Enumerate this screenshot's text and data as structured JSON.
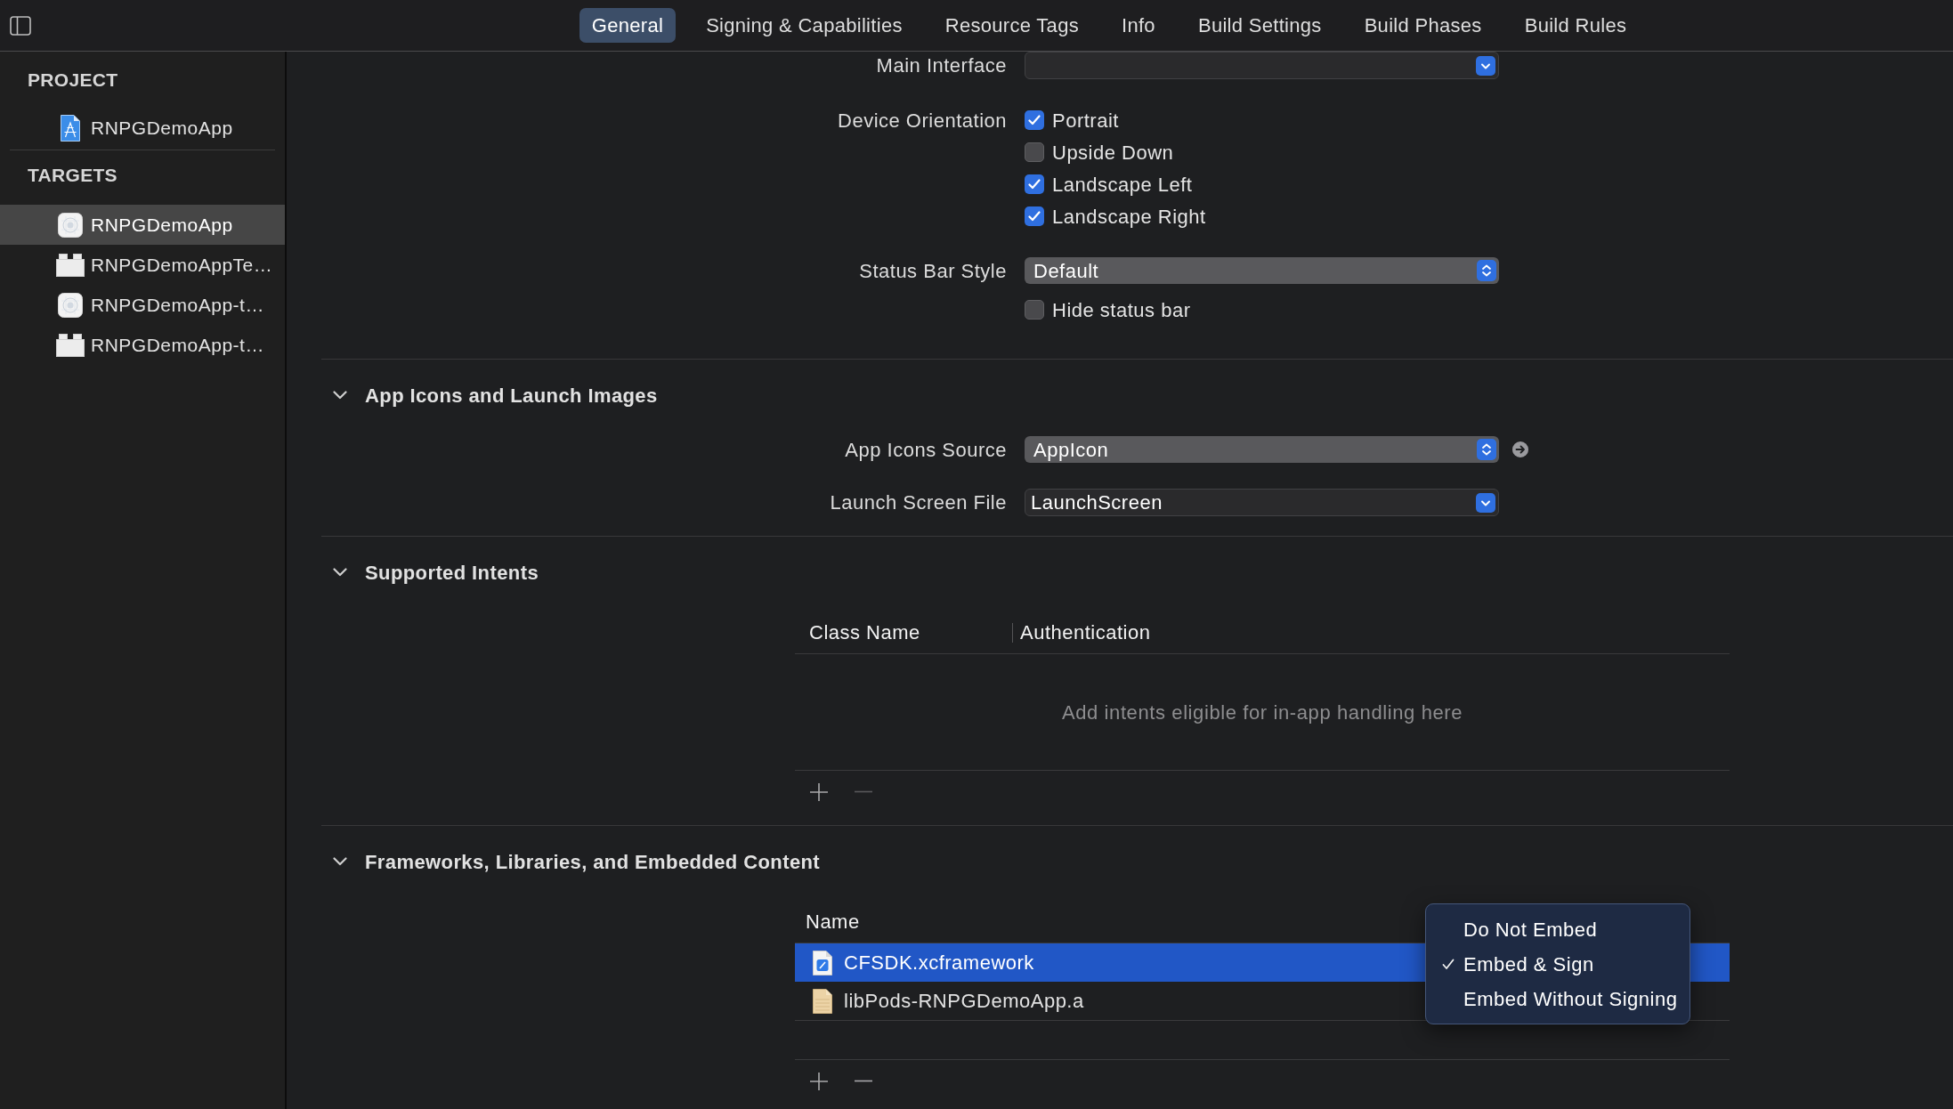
{
  "toolbar": {
    "tabs": [
      {
        "label": "General",
        "selected": true
      },
      {
        "label": "Signing & Capabilities",
        "selected": false
      },
      {
        "label": "Resource Tags",
        "selected": false
      },
      {
        "label": "Info",
        "selected": false
      },
      {
        "label": "Build Settings",
        "selected": false
      },
      {
        "label": "Build Phases",
        "selected": false
      },
      {
        "label": "Build Rules",
        "selected": false
      }
    ]
  },
  "sidebar": {
    "groups": [
      {
        "title": "PROJECT",
        "items": [
          {
            "label": "RNPGDemoApp",
            "kind": "project",
            "selected": false
          }
        ]
      },
      {
        "title": "TARGETS",
        "items": [
          {
            "label": "RNPGDemoApp",
            "kind": "app",
            "selected": true
          },
          {
            "label": "RNPGDemoAppTe…",
            "kind": "bundle",
            "selected": false
          },
          {
            "label": "RNPGDemoApp-t…",
            "kind": "app",
            "selected": false
          },
          {
            "label": "RNPGDemoApp-t…",
            "kind": "bundle",
            "selected": false
          }
        ]
      }
    ]
  },
  "sections": [
    {
      "rows": [
        {
          "kind": "popup",
          "label": "Main Interface"
        },
        {
          "kind": "checkboxes",
          "label": "Device Orientation",
          "options": [
            {
              "label": "Portrait",
              "checked": true
            },
            {
              "label": "Upside Down",
              "checked": false
            },
            {
              "label": "Landscape Left",
              "checked": true
            },
            {
              "label": "Landscape Right",
              "checked": true
            }
          ]
        },
        {
          "kind": "stepper",
          "label": "Status Bar Style",
          "value": "Default"
        },
        {
          "kind": "checkboxes",
          "options": [
            {
              "label": "Hide status bar",
              "checked": false
            }
          ]
        }
      ]
    },
    {
      "title": "App Icons and Launch Images",
      "expanded": true,
      "rows": [
        {
          "kind": "stepper",
          "label": "App Icons Source",
          "value": "AppIcon",
          "go_arrow": true
        },
        {
          "kind": "popup",
          "label": "Launch Screen File",
          "value": "LaunchScreen"
        }
      ]
    },
    {
      "title": "Supported Intents",
      "expanded": true,
      "table": {
        "columns": [
          "Class Name",
          "Authentication"
        ],
        "empty_text": "Add intents eligible for in-app handling here",
        "buttons": [
          {
            "kind": "add",
            "disabled": false
          },
          {
            "kind": "remove",
            "disabled": true
          }
        ]
      }
    },
    {
      "title": "Frameworks, Libraries, and Embedded Content",
      "expanded": true,
      "table": {
        "columns": [
          "Name"
        ],
        "rows": [
          {
            "name": "CFSDK.xcframework",
            "kind": "xcframework",
            "selected": true
          },
          {
            "name": "libPods-RNPGDemoApp.a",
            "kind": "library",
            "selected": false
          }
        ],
        "buttons": [
          {
            "kind": "add",
            "disabled": false
          },
          {
            "kind": "remove",
            "disabled": false
          }
        ],
        "menu": {
          "items": [
            {
              "label": "Do Not Embed",
              "checked": false
            },
            {
              "label": "Embed & Sign",
              "checked": true
            },
            {
              "label": "Embed Without Signing",
              "checked": false
            }
          ]
        }
      }
    }
  ]
}
